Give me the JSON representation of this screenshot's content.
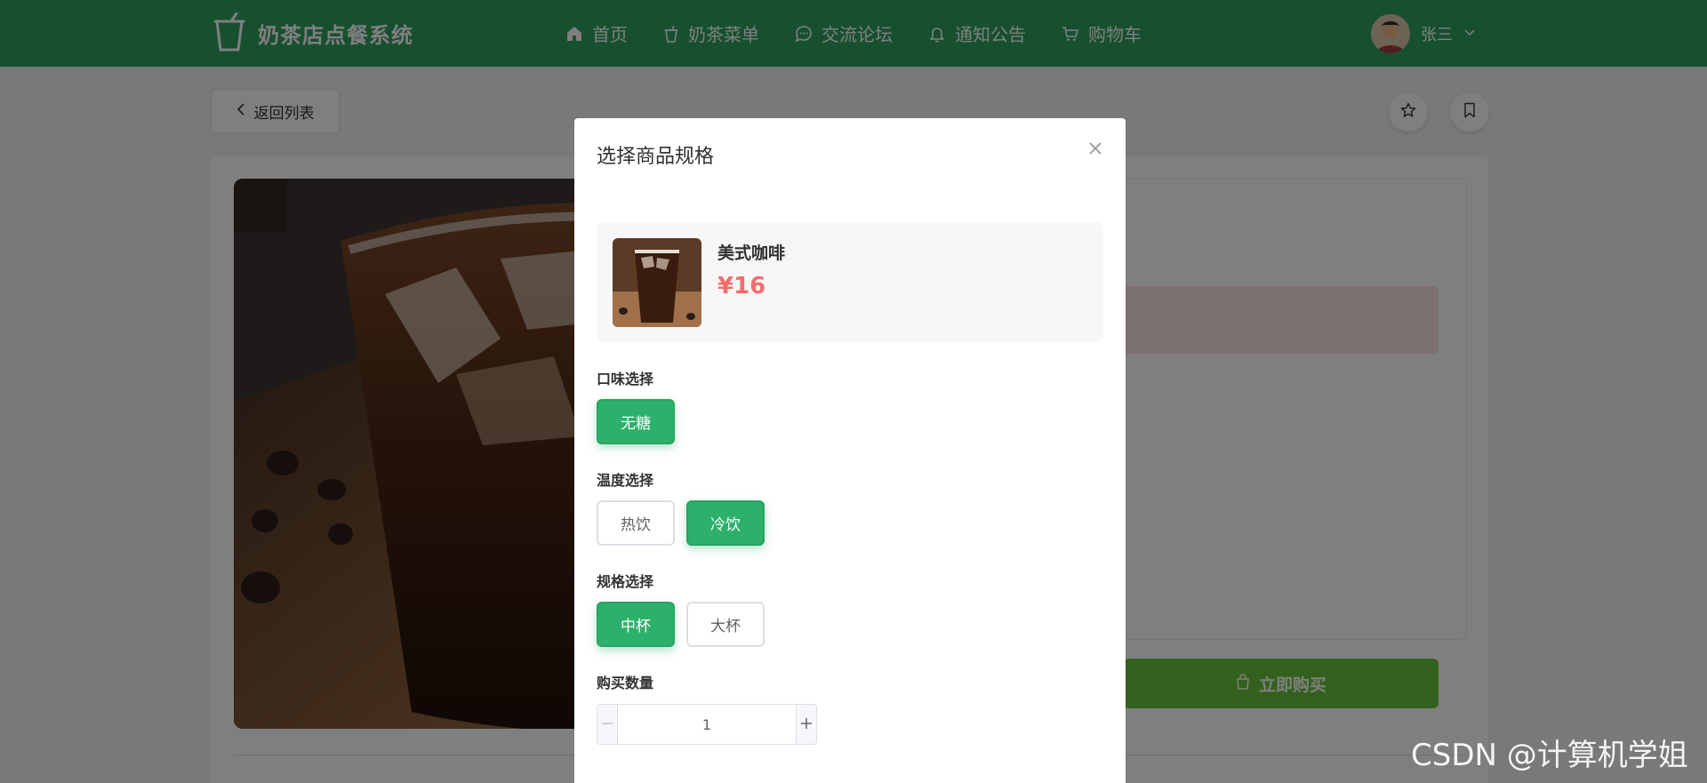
{
  "header": {
    "app_name": "奶茶店点餐系统",
    "nav": [
      {
        "label": "首页",
        "icon": "home-icon"
      },
      {
        "label": "奶茶菜单",
        "icon": "cup-icon"
      },
      {
        "label": "交流论坛",
        "icon": "chat-bubble-icon"
      },
      {
        "label": "通知公告",
        "icon": "bell-icon"
      },
      {
        "label": "购物车",
        "icon": "cart-icon"
      }
    ],
    "user_name": "张三"
  },
  "page": {
    "back_label": "返回列表",
    "buy_now_label": "立即购买"
  },
  "dialog": {
    "title": "选择商品规格",
    "product": {
      "name": "美式咖啡",
      "price": "¥16"
    },
    "taste": {
      "label": "口味选择",
      "options": [
        "无糖"
      ],
      "selected": "无糖"
    },
    "temperature": {
      "label": "温度选择",
      "options": [
        "热饮",
        "冷饮"
      ],
      "selected": "冷饮"
    },
    "size": {
      "label": "规格选择",
      "options": [
        "中杯",
        "大杯"
      ],
      "selected": "中杯"
    },
    "quantity": {
      "label": "购买数量",
      "value": "1"
    }
  },
  "watermark": "CSDN @计算机学姐",
  "colors": {
    "header_green": "#2ea05e",
    "accent_green": "#2db06b",
    "price_red": "#f56c6c",
    "buy_green": "#67c23a"
  }
}
